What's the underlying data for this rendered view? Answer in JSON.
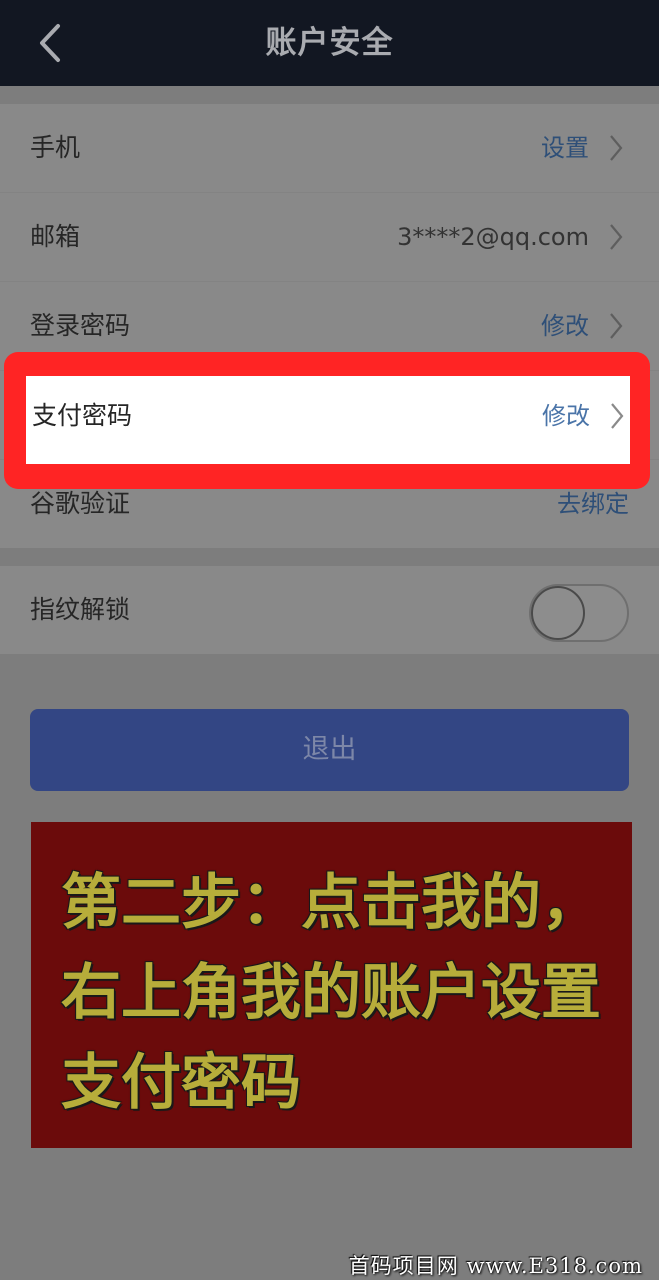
{
  "header": {
    "title": "账户安全",
    "back_icon": "chevron-left-icon"
  },
  "security": {
    "rows": [
      {
        "label": "手机",
        "value": "设置"
      },
      {
        "label": "邮箱",
        "value": "3****2@qq.com"
      },
      {
        "label": "登录密码",
        "value": "修改"
      },
      {
        "label": "支付密码",
        "value": "修改"
      },
      {
        "label": "谷歌验证",
        "value": "去绑定"
      }
    ]
  },
  "fingerprint": {
    "label": "指纹解锁",
    "enabled": false
  },
  "logout_label": "退出",
  "annotation": {
    "text": "第二步：点击我的，右上角我的账户设置支付密码",
    "highlight_color": "#ff2424",
    "banner_color": "#6b0b0b",
    "text_color": "#b7ad3a"
  },
  "watermark": "首码项目网 www.E318.com",
  "colors": {
    "header_bg": "#121722",
    "accent": "#334684",
    "link": "#2e4f78"
  }
}
